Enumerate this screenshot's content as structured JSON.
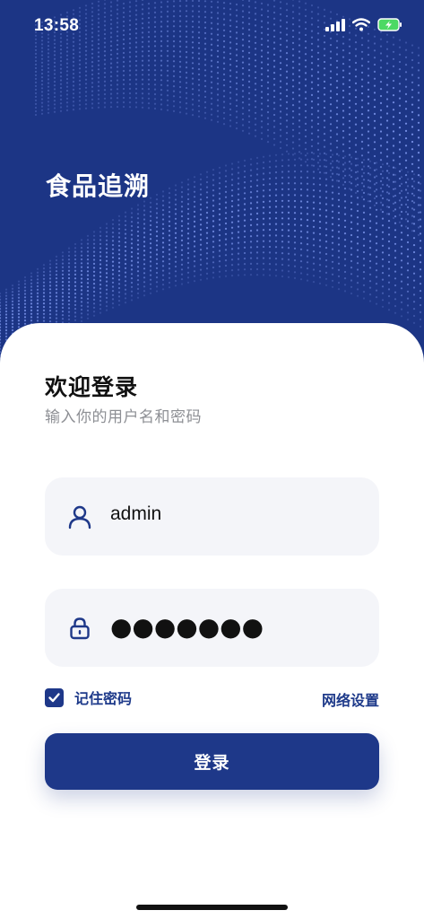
{
  "status_bar": {
    "time": "13:58",
    "icons": [
      "signal-icon",
      "wifi-icon",
      "battery-charging-icon"
    ]
  },
  "app": {
    "title": "食品追溯",
    "hero_color": "#1c3585"
  },
  "login": {
    "title": "欢迎登录",
    "subtitle": "输入你的用户名和密码",
    "username": {
      "value": "admin",
      "icon": "user-icon"
    },
    "password": {
      "masked_value": "●●●●●●●",
      "icon": "lock-icon"
    },
    "remember_label": "记住密码",
    "remember_checked": true,
    "network_settings_label": "网络设置",
    "submit_label": "登录"
  },
  "colors": {
    "accent": "#1e3889",
    "field_bg": "#f4f5f9",
    "subtitle": "#8d8f94"
  }
}
